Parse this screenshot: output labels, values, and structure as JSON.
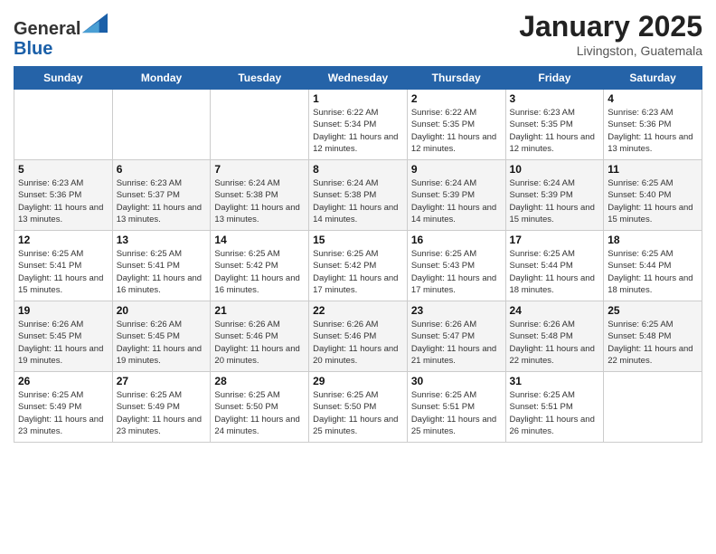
{
  "header": {
    "logo_line1": "General",
    "logo_line2": "Blue",
    "month": "January 2025",
    "location": "Livingston, Guatemala"
  },
  "days_of_week": [
    "Sunday",
    "Monday",
    "Tuesday",
    "Wednesday",
    "Thursday",
    "Friday",
    "Saturday"
  ],
  "weeks": [
    [
      {
        "day": "",
        "info": ""
      },
      {
        "day": "",
        "info": ""
      },
      {
        "day": "",
        "info": ""
      },
      {
        "day": "1",
        "info": "Sunrise: 6:22 AM\nSunset: 5:34 PM\nDaylight: 11 hours and 12 minutes."
      },
      {
        "day": "2",
        "info": "Sunrise: 6:22 AM\nSunset: 5:35 PM\nDaylight: 11 hours and 12 minutes."
      },
      {
        "day": "3",
        "info": "Sunrise: 6:23 AM\nSunset: 5:35 PM\nDaylight: 11 hours and 12 minutes."
      },
      {
        "day": "4",
        "info": "Sunrise: 6:23 AM\nSunset: 5:36 PM\nDaylight: 11 hours and 13 minutes."
      }
    ],
    [
      {
        "day": "5",
        "info": "Sunrise: 6:23 AM\nSunset: 5:36 PM\nDaylight: 11 hours and 13 minutes."
      },
      {
        "day": "6",
        "info": "Sunrise: 6:23 AM\nSunset: 5:37 PM\nDaylight: 11 hours and 13 minutes."
      },
      {
        "day": "7",
        "info": "Sunrise: 6:24 AM\nSunset: 5:38 PM\nDaylight: 11 hours and 13 minutes."
      },
      {
        "day": "8",
        "info": "Sunrise: 6:24 AM\nSunset: 5:38 PM\nDaylight: 11 hours and 14 minutes."
      },
      {
        "day": "9",
        "info": "Sunrise: 6:24 AM\nSunset: 5:39 PM\nDaylight: 11 hours and 14 minutes."
      },
      {
        "day": "10",
        "info": "Sunrise: 6:24 AM\nSunset: 5:39 PM\nDaylight: 11 hours and 15 minutes."
      },
      {
        "day": "11",
        "info": "Sunrise: 6:25 AM\nSunset: 5:40 PM\nDaylight: 11 hours and 15 minutes."
      }
    ],
    [
      {
        "day": "12",
        "info": "Sunrise: 6:25 AM\nSunset: 5:41 PM\nDaylight: 11 hours and 15 minutes."
      },
      {
        "day": "13",
        "info": "Sunrise: 6:25 AM\nSunset: 5:41 PM\nDaylight: 11 hours and 16 minutes."
      },
      {
        "day": "14",
        "info": "Sunrise: 6:25 AM\nSunset: 5:42 PM\nDaylight: 11 hours and 16 minutes."
      },
      {
        "day": "15",
        "info": "Sunrise: 6:25 AM\nSunset: 5:42 PM\nDaylight: 11 hours and 17 minutes."
      },
      {
        "day": "16",
        "info": "Sunrise: 6:25 AM\nSunset: 5:43 PM\nDaylight: 11 hours and 17 minutes."
      },
      {
        "day": "17",
        "info": "Sunrise: 6:25 AM\nSunset: 5:44 PM\nDaylight: 11 hours and 18 minutes."
      },
      {
        "day": "18",
        "info": "Sunrise: 6:25 AM\nSunset: 5:44 PM\nDaylight: 11 hours and 18 minutes."
      }
    ],
    [
      {
        "day": "19",
        "info": "Sunrise: 6:26 AM\nSunset: 5:45 PM\nDaylight: 11 hours and 19 minutes."
      },
      {
        "day": "20",
        "info": "Sunrise: 6:26 AM\nSunset: 5:45 PM\nDaylight: 11 hours and 19 minutes."
      },
      {
        "day": "21",
        "info": "Sunrise: 6:26 AM\nSunset: 5:46 PM\nDaylight: 11 hours and 20 minutes."
      },
      {
        "day": "22",
        "info": "Sunrise: 6:26 AM\nSunset: 5:46 PM\nDaylight: 11 hours and 20 minutes."
      },
      {
        "day": "23",
        "info": "Sunrise: 6:26 AM\nSunset: 5:47 PM\nDaylight: 11 hours and 21 minutes."
      },
      {
        "day": "24",
        "info": "Sunrise: 6:26 AM\nSunset: 5:48 PM\nDaylight: 11 hours and 22 minutes."
      },
      {
        "day": "25",
        "info": "Sunrise: 6:25 AM\nSunset: 5:48 PM\nDaylight: 11 hours and 22 minutes."
      }
    ],
    [
      {
        "day": "26",
        "info": "Sunrise: 6:25 AM\nSunset: 5:49 PM\nDaylight: 11 hours and 23 minutes."
      },
      {
        "day": "27",
        "info": "Sunrise: 6:25 AM\nSunset: 5:49 PM\nDaylight: 11 hours and 23 minutes."
      },
      {
        "day": "28",
        "info": "Sunrise: 6:25 AM\nSunset: 5:50 PM\nDaylight: 11 hours and 24 minutes."
      },
      {
        "day": "29",
        "info": "Sunrise: 6:25 AM\nSunset: 5:50 PM\nDaylight: 11 hours and 25 minutes."
      },
      {
        "day": "30",
        "info": "Sunrise: 6:25 AM\nSunset: 5:51 PM\nDaylight: 11 hours and 25 minutes."
      },
      {
        "day": "31",
        "info": "Sunrise: 6:25 AM\nSunset: 5:51 PM\nDaylight: 11 hours and 26 minutes."
      },
      {
        "day": "",
        "info": ""
      }
    ]
  ]
}
